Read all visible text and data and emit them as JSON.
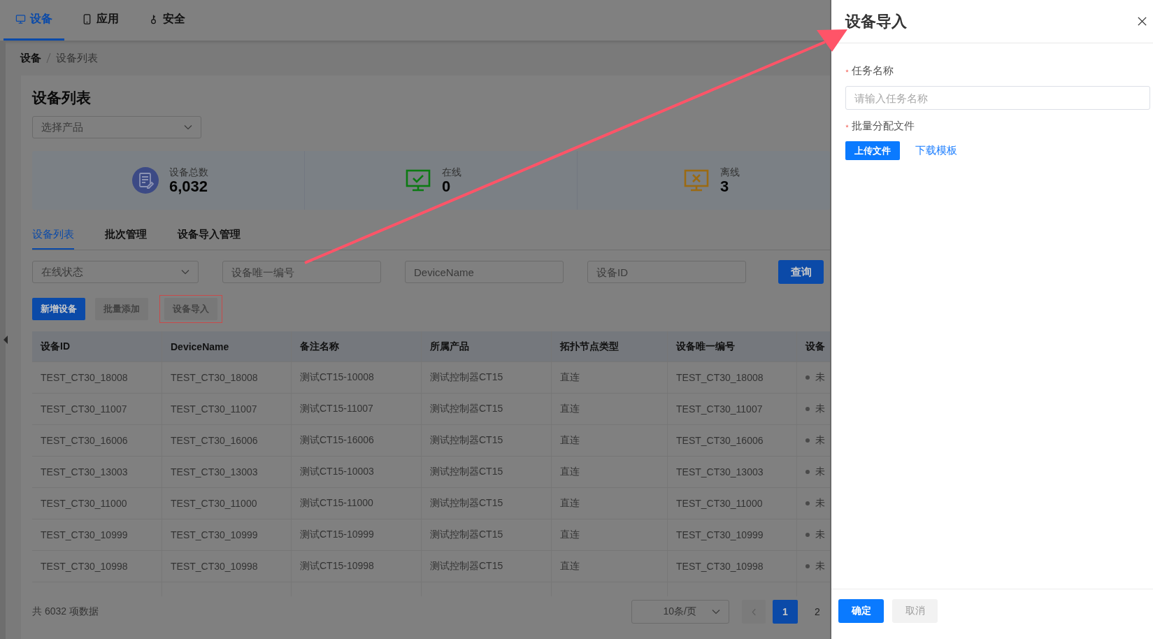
{
  "nav_tabs": [
    {
      "label": "设备",
      "selected": true
    },
    {
      "label": "应用",
      "selected": false
    },
    {
      "label": "安全",
      "selected": false
    }
  ],
  "breadcrumb": [
    "设备",
    "设备列表"
  ],
  "page_title": "设备列表",
  "product_select": {
    "placeholder": "选择产品"
  },
  "stats": [
    {
      "kind": "total",
      "label": "设备总数",
      "value": "6,032"
    },
    {
      "kind": "online",
      "label": "在线",
      "value": "0"
    },
    {
      "kind": "offline",
      "label": "离线",
      "value": "3"
    }
  ],
  "sub_tabs": [
    {
      "label": "设备列表",
      "selected": true
    },
    {
      "label": "批次管理",
      "selected": false
    },
    {
      "label": "设备导入管理",
      "selected": false
    }
  ],
  "filters": {
    "status_select": {
      "placeholder": "在线状态"
    },
    "inputs": [
      {
        "placeholder": "设备唯一编号"
      },
      {
        "placeholder": "DeviceName"
      },
      {
        "placeholder": "设备ID"
      }
    ],
    "query_button": "查询"
  },
  "actions": [
    {
      "label": "新增设备",
      "kind": "primary",
      "highlighted": false
    },
    {
      "label": "批量添加",
      "kind": "secondary",
      "highlighted": false
    },
    {
      "label": "设备导入",
      "kind": "secondary",
      "highlighted": true
    }
  ],
  "table": {
    "columns": [
      "设备ID",
      "DeviceName",
      "备注名称",
      "所属产品",
      "拓扑节点类型",
      "设备唯一编号",
      "设备"
    ],
    "rows": [
      [
        "TEST_CT30_18008",
        "TEST_CT30_18008",
        "测试CT15-10008",
        "测试控制器CT15",
        "直连",
        "TEST_CT30_18008",
        "未"
      ],
      [
        "TEST_CT30_11007",
        "TEST_CT30_11007",
        "测试CT15-11007",
        "测试控制器CT15",
        "直连",
        "TEST_CT30_11007",
        "未"
      ],
      [
        "TEST_CT30_16006",
        "TEST_CT30_16006",
        "测试CT15-16006",
        "测试控制器CT15",
        "直连",
        "TEST_CT30_16006",
        "未"
      ],
      [
        "TEST_CT30_13003",
        "TEST_CT30_13003",
        "测试CT15-10003",
        "测试控制器CT15",
        "直连",
        "TEST_CT30_13003",
        "未"
      ],
      [
        "TEST_CT30_11000",
        "TEST_CT30_11000",
        "测试CT15-11000",
        "测试控制器CT15",
        "直连",
        "TEST_CT30_11000",
        "未"
      ],
      [
        "TEST_CT30_10999",
        "TEST_CT30_10999",
        "测试CT15-10999",
        "测试控制器CT15",
        "直连",
        "TEST_CT30_10999",
        "未"
      ],
      [
        "TEST_CT30_10998",
        "TEST_CT30_10998",
        "测试CT15-10998",
        "测试控制器CT15",
        "直连",
        "TEST_CT30_10998",
        "未"
      ]
    ]
  },
  "pagination": {
    "total": "共 6032 项数据",
    "page_size": "10条/页",
    "pages": [
      {
        "label": "1",
        "selected": true
      },
      {
        "label": "2",
        "selected": false
      }
    ]
  },
  "drawer": {
    "title": "设备导入",
    "fields": [
      {
        "kind": "input",
        "label": "任务名称",
        "required": true,
        "placeholder": "请输入任务名称"
      },
      {
        "kind": "upload",
        "label": "批量分配文件",
        "required": true,
        "button": "上传文件",
        "link": "下载模板"
      }
    ],
    "buttons": [
      {
        "label": "确定",
        "kind": "primary"
      },
      {
        "label": "取消",
        "kind": "secondary"
      }
    ]
  }
}
